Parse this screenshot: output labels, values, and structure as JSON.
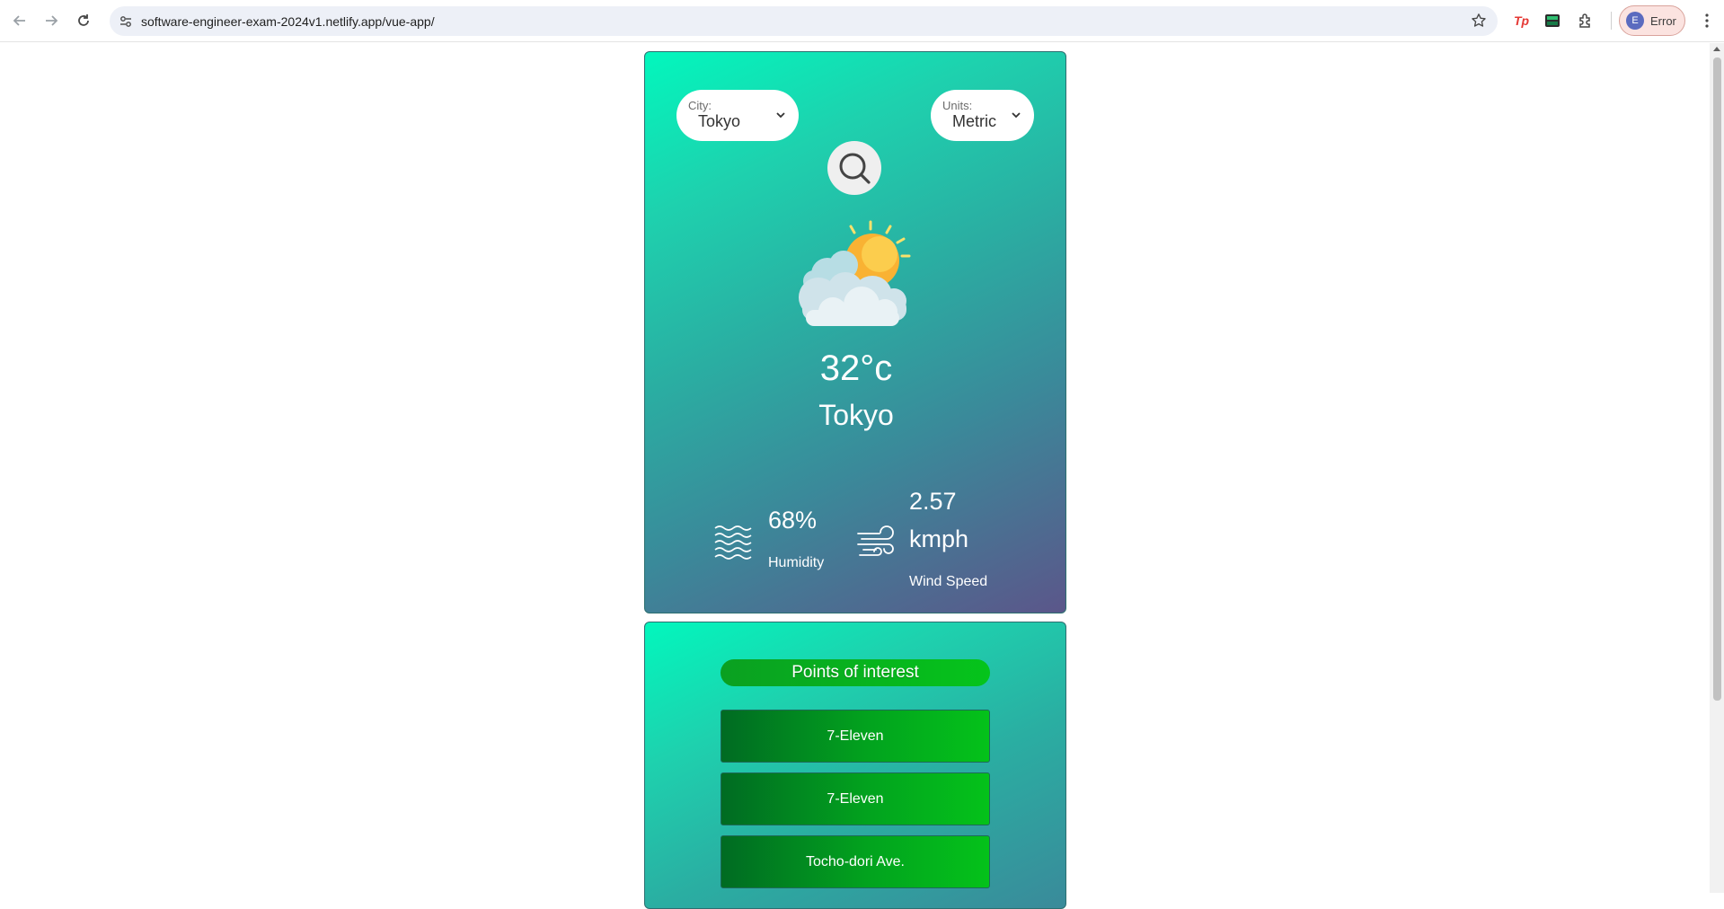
{
  "browser": {
    "url": "software-engineer-exam-2024v1.netlify.app/vue-app/",
    "profile_initial": "E",
    "profile_label": "Error"
  },
  "weather": {
    "city_caption": "City:",
    "city_value": "Tokyo",
    "units_caption": "Units:",
    "units_value": "Metric",
    "temperature": "32°c",
    "city_name": "Tokyo",
    "humidity_value": "68%",
    "humidity_label": "Humidity",
    "wind_value_line1": "2.57",
    "wind_value_line2": "kmph",
    "wind_label": "Wind Speed",
    "condition_icon": "partly-cloudy-icon"
  },
  "poi": {
    "title": "Points of interest",
    "items": [
      "7-Eleven",
      "7-Eleven",
      "Tocho-dori Ave."
    ]
  },
  "colors": {
    "card_gradient_start": "#02f7bd",
    "card_gradient_end": "#5b568a",
    "poi_button_dark": "#006b22",
    "poi_button_light": "#04c21a"
  }
}
